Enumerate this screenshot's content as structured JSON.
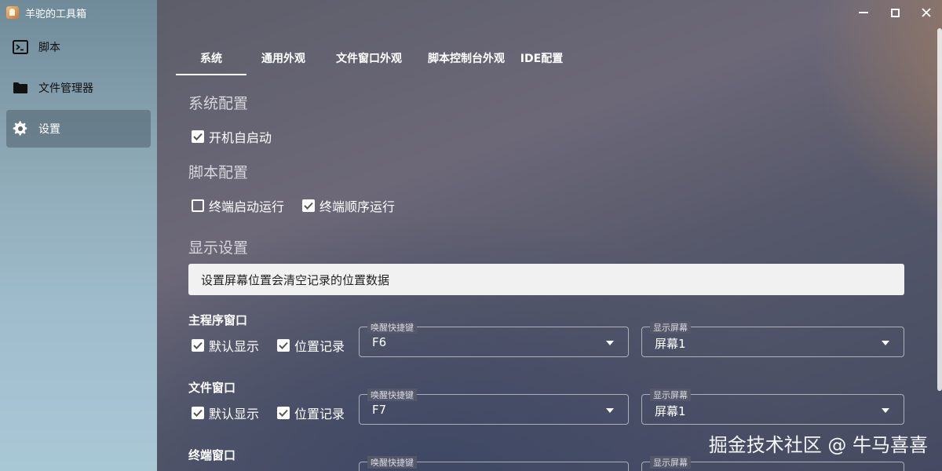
{
  "window": {
    "title": "羊驼的工具箱"
  },
  "sidebar": {
    "items": [
      {
        "label": "脚本",
        "icon": "terminal-icon"
      },
      {
        "label": "文件管理器",
        "icon": "folder-icon"
      },
      {
        "label": "设置",
        "icon": "gear-icon",
        "active": true
      }
    ]
  },
  "tabs": [
    {
      "label": "系统",
      "active": true
    },
    {
      "label": "通用外观"
    },
    {
      "label": "文件窗口外观"
    },
    {
      "label": "脚本控制台外观"
    },
    {
      "label": "IDE配置"
    }
  ],
  "system": {
    "title": "系统配置",
    "autostart": {
      "label": "开机自启动",
      "checked": true
    }
  },
  "script": {
    "title": "脚本配置",
    "terminal_autostart": {
      "label": "终端启动运行",
      "checked": false
    },
    "terminal_sequential": {
      "label": "终端顺序运行",
      "checked": true
    }
  },
  "display": {
    "title": "显示设置",
    "notice": "设置屏幕位置会清空记录的位置数据",
    "groups": [
      {
        "title": "主程序窗口",
        "default_show": {
          "label": "默认显示",
          "checked": true
        },
        "remember_pos": {
          "label": "位置记录",
          "checked": true
        },
        "hotkey": {
          "legend": "唤醒快捷键",
          "value": "F6"
        },
        "screen": {
          "legend": "显示屏幕",
          "value": "屏幕1"
        }
      },
      {
        "title": "文件窗口",
        "default_show": {
          "label": "默认显示",
          "checked": true
        },
        "remember_pos": {
          "label": "位置记录",
          "checked": true
        },
        "hotkey": {
          "legend": "唤醒快捷键",
          "value": "F7"
        },
        "screen": {
          "legend": "显示屏幕",
          "value": "屏幕1"
        }
      },
      {
        "title": "终端窗口",
        "hotkey": {
          "legend": "唤醒快捷键",
          "value": ""
        },
        "screen": {
          "legend": "显示屏幕",
          "value": ""
        }
      }
    ]
  },
  "watermark": "掘金技术社区 @ 牛马喜喜"
}
